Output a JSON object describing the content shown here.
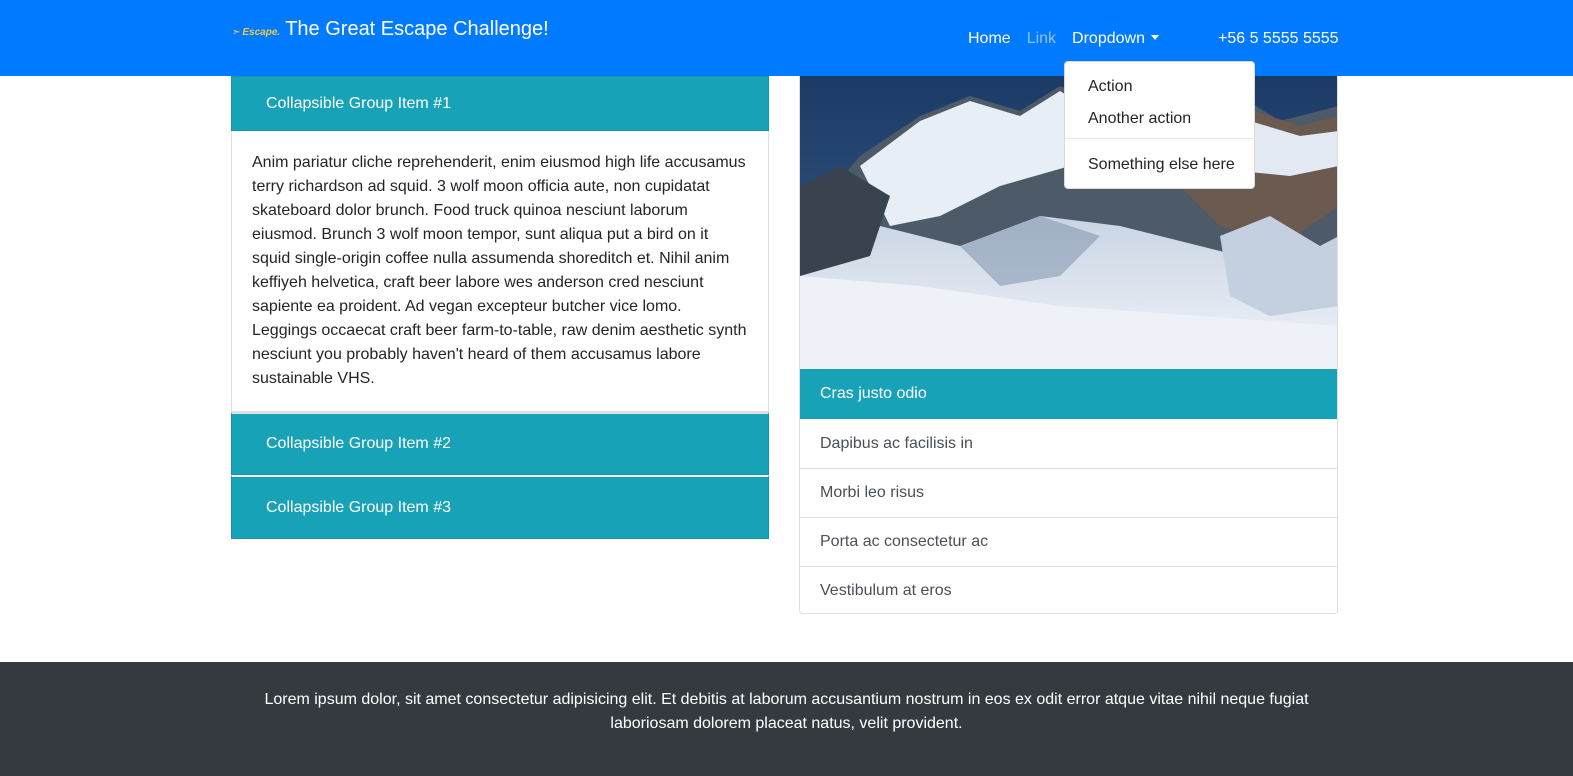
{
  "navbar": {
    "logo_text": "Escape.",
    "brand_title": "The Great Escape Challenge!",
    "links": [
      {
        "label": "Home"
      },
      {
        "label": "Link"
      },
      {
        "label": "Dropdown"
      }
    ],
    "phone": "+56 5 5555 5555",
    "colors": {
      "background": "#007bff"
    }
  },
  "dropdown": {
    "items": [
      "Action",
      "Another action",
      "Something else here"
    ]
  },
  "accordion": {
    "items": [
      {
        "title": "Collapsible Group Item #1",
        "expanded": true
      },
      {
        "title": "Collapsible Group Item #2",
        "expanded": false
      },
      {
        "title": "Collapsible Group Item #3",
        "expanded": false
      }
    ],
    "body": "Anim pariatur cliche reprehenderit, enim eiusmod high life accusamus terry richardson ad squid. 3 wolf moon officia aute, non cupidatat skateboard dolor brunch. Food truck quinoa nesciunt laborum eiusmod. Brunch 3 wolf moon tempor, sunt aliqua put a bird on it squid single-origin coffee nulla assumenda shoreditch et. Nihil anim keffiyeh helvetica, craft beer labore wes anderson cred nesciunt sapiente ea proident. Ad vegan excepteur butcher vice lomo. Leggings occaecat craft beer farm-to-table, raw denim aesthetic synth nesciunt you probably haven't heard of them accusamus labore sustainable VHS.",
    "colors": {
      "header": "#17a2b8"
    }
  },
  "card": {
    "image": "mountain-glacier-photo",
    "list_header": "Cras justo odio",
    "list_items": [
      "Dapibus ac facilisis in",
      "Morbi leo risus",
      "Porta ac consectetur ac",
      "Vestibulum at eros"
    ]
  },
  "footer": {
    "text": "Lorem ipsum dolor, sit amet consectetur adipisicing elit. Et debitis at laborum accusantium nostrum in eos ex odit error atque vitae nihil neque fugiat laboriosam dolorem placeat natus, velit provident.",
    "colors": {
      "background": "#343a40"
    }
  }
}
